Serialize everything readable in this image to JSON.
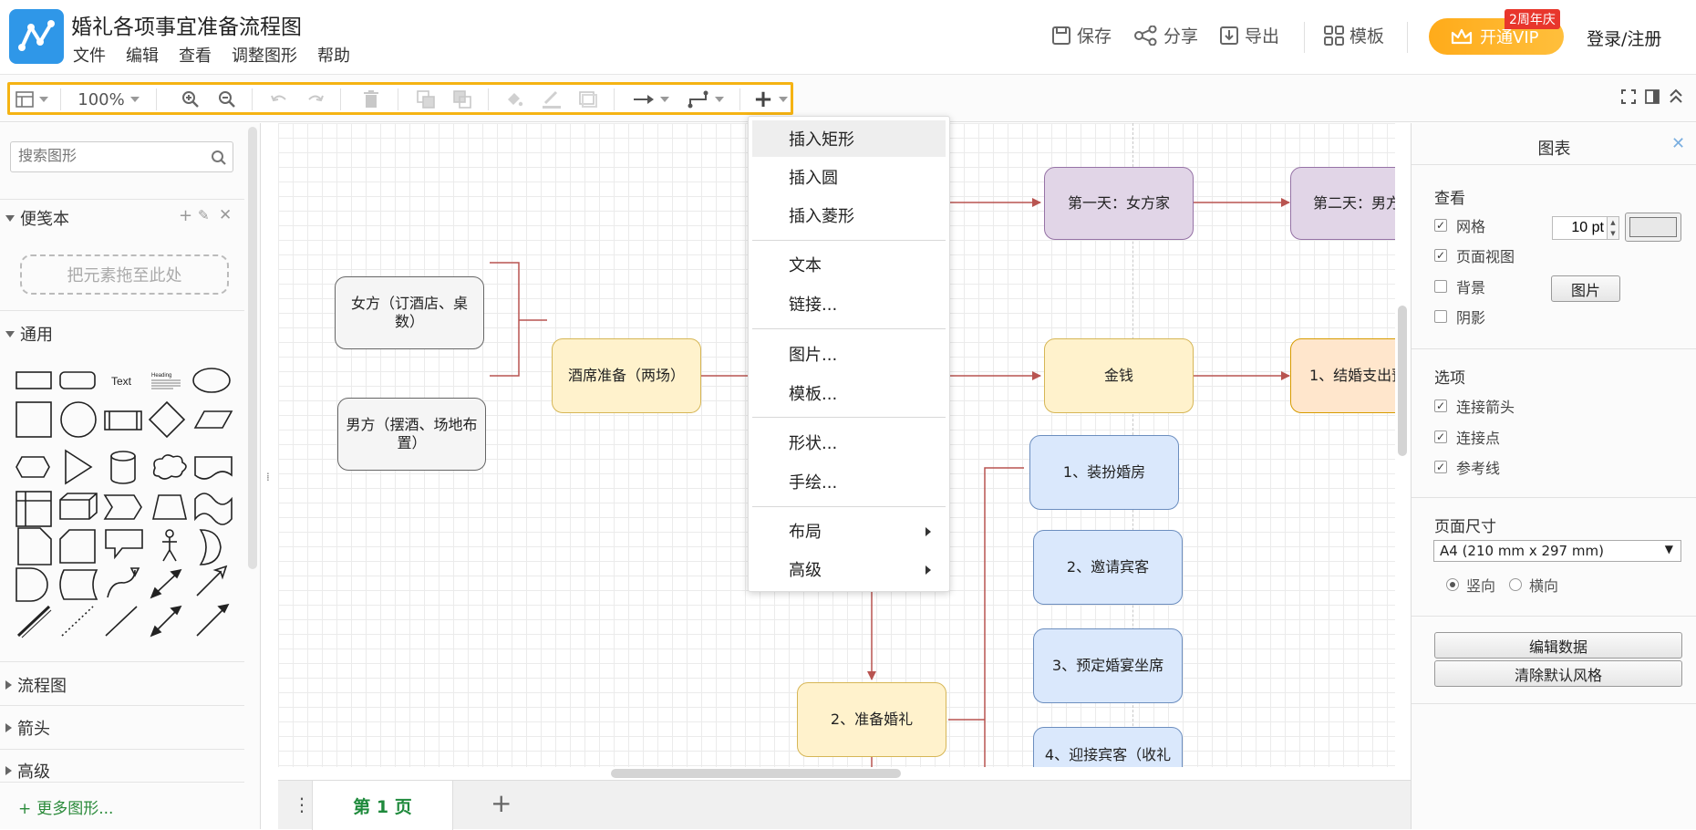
{
  "app": {
    "doc_title": "婚礼各项事宜准备流程图",
    "menu": [
      "文件",
      "编辑",
      "查看",
      "调整图形",
      "帮助"
    ],
    "actions": {
      "save": "保存",
      "share": "分享",
      "export": "导出",
      "template": "模板"
    },
    "vip": {
      "label": "开通VIP",
      "badge": "2周年庆",
      "color": "#ffb020"
    },
    "login": "登录/注册"
  },
  "toolbar": {
    "zoom": "100%",
    "accent": "#f5b313"
  },
  "left_panel": {
    "search_placeholder": "搜索图形",
    "sections": {
      "scratchpad": "便笺本",
      "general": "通用",
      "flowchart": "流程图",
      "arrows": "箭头",
      "advanced": "高级"
    },
    "drop_hint": "把元素拖至此处",
    "shape_text_sample": "Text",
    "shape_heading_sample": "Heading",
    "more_shapes": "更多图形..."
  },
  "canvas": {
    "nodes": {
      "bride_family_day": "第一天：女方家",
      "groom_family_day": "第二天：男方",
      "bride_side": "女方（订酒店、桌数）",
      "groom_side": "男方（摆酒、场地布置）",
      "banquet": "酒席准备（两场）",
      "money": "金钱",
      "expense": "1、结婚支出预",
      "decorate": "1、装扮婚房",
      "invite": "2、邀请宾客",
      "seating": "3、预定婚宴坐席",
      "welcome": "4、迎接宾客（收礼",
      "prepare_wedding": "2、准备婚礼"
    },
    "edge_color": "#b85450"
  },
  "page_tabs": {
    "active": "第 1 页"
  },
  "context_menu": {
    "items": [
      "插入矩形",
      "插入圆",
      "插入菱形",
      "文本",
      "链接...",
      "图片...",
      "模板...",
      "形状...",
      "手绘...",
      "布局",
      "高级"
    ],
    "highlighted": "插入矩形"
  },
  "right_panel": {
    "title": "图表",
    "view_heading": "查看",
    "grid": "网格",
    "grid_size": "10 pt",
    "page_view": "页面视图",
    "background": "背景",
    "image_btn": "图片",
    "shadow": "阴影",
    "options_heading": "选项",
    "connect_arrows": "连接箭头",
    "connection_points": "连接点",
    "guides": "参考线",
    "page_size_heading": "页面尺寸",
    "page_size": "A4 (210 mm x 297 mm)",
    "portrait": "竖向",
    "landscape": "横向",
    "edit_data": "编辑数据",
    "clear_style": "清除默认风格",
    "checked": {
      "grid": true,
      "page_view": true,
      "background": false,
      "shadow": false,
      "connect_arrows": true,
      "connection_points": true,
      "guides": true
    },
    "orientation": "portrait"
  }
}
